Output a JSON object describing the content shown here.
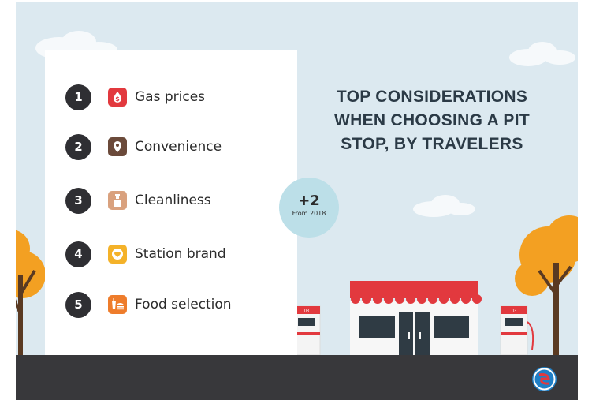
{
  "title_lines": [
    "TOP CONSIDERATIONS",
    "WHEN CHOOSING A PIT",
    "STOP, BY TRAVELERS"
  ],
  "items": [
    {
      "rank": "1",
      "label": "Gas prices",
      "icon": "dollar-drop-icon",
      "color": "#e2393e"
    },
    {
      "rank": "2",
      "label": "Convenience",
      "icon": "map-pin-icon",
      "color": "#6b4a3a"
    },
    {
      "rank": "3",
      "label": "Cleanliness",
      "icon": "spray-bottle-icon",
      "color": "#d9a17e"
    },
    {
      "rank": "4",
      "label": "Station brand",
      "icon": "heart-icon",
      "color": "#f4b229"
    },
    {
      "rank": "5",
      "label": "Food selection",
      "icon": "cup-burger-icon",
      "color": "#ee7c2b"
    }
  ],
  "badge": {
    "value": "+2",
    "note": "From 2018"
  },
  "pump_label": "03",
  "colors": {
    "sky": "#dce9f0",
    "road": "#38383b",
    "awning": "#e2393e",
    "arrow": "#ee7c2b",
    "tree": "#f3a022",
    "badge": "#bcdfe8"
  }
}
